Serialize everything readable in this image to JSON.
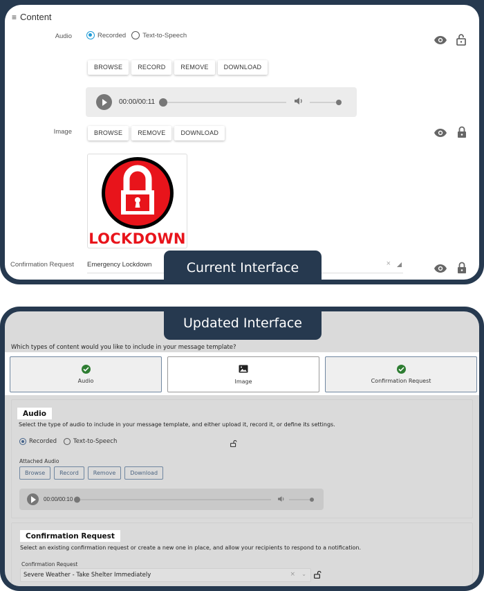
{
  "current": {
    "tab_label": "Current Interface",
    "header": {
      "icon": "hamburger-menu-icon",
      "title": "Content"
    },
    "audio": {
      "label": "Audio",
      "radios": [
        {
          "label": "Recorded",
          "selected": true
        },
        {
          "label": "Text-to-Speech",
          "selected": false
        }
      ],
      "buttons": [
        "BROWSE",
        "RECORD",
        "REMOVE",
        "DOWNLOAD"
      ],
      "player": {
        "time": "00:00/00:11",
        "progress": 0,
        "volume": 1.0
      },
      "visibility_icon": "eye-icon",
      "lock_icon": "unlocked-icon"
    },
    "image": {
      "label": "Image",
      "buttons": [
        "BROWSE",
        "REMOVE",
        "DOWNLOAD"
      ],
      "preview_caption": "LOCKDOWN",
      "visibility_icon": "eye-icon",
      "lock_icon": "locked-icon"
    },
    "confirmation": {
      "label": "Confirmation Request",
      "value": "Emergency Lockdown",
      "visibility_icon": "eye-icon",
      "lock_icon": "locked-icon"
    }
  },
  "updated": {
    "tab_label": "Updated Interface",
    "question": "Which types of content would you like to include in your message template?",
    "content_types": [
      {
        "label": "Audio",
        "selected": true,
        "icon": "check-circle-icon"
      },
      {
        "label": "Image",
        "selected": false,
        "icon": "image-icon"
      },
      {
        "label": "Confirmation Request",
        "selected": true,
        "icon": "check-circle-icon"
      }
    ],
    "audio_section": {
      "title": "Audio",
      "description": "Select the type of audio to include in your message template, and either upload it, record it, or define its settings.",
      "radios": [
        {
          "label": "Recorded",
          "selected": true
        },
        {
          "label": "Text-to-Speech",
          "selected": false
        }
      ],
      "lock_icon": "unlocked-icon",
      "attached_label": "Attached Audio",
      "buttons": [
        "Browse",
        "Record",
        "Remove",
        "Download"
      ],
      "player": {
        "time": "00:00/00:10",
        "progress": 0,
        "volume": 1.0
      }
    },
    "confirmation_section": {
      "title": "Confirmation Request",
      "description": "Select an existing confirmation request or create a new one in place, and allow your recipients to respond to a notification.",
      "field_label": "Confirmation Request",
      "value": "Severe Weather - Take Shelter Immediately",
      "lock_icon": "unlocked-icon"
    }
  },
  "colors": {
    "frame": "#26394f",
    "radio_accent_current": "#1e9ad6",
    "check_green": "#2e7d32",
    "lockdown_red": "#e8141b",
    "updated_button_border": "#6f86a0"
  }
}
